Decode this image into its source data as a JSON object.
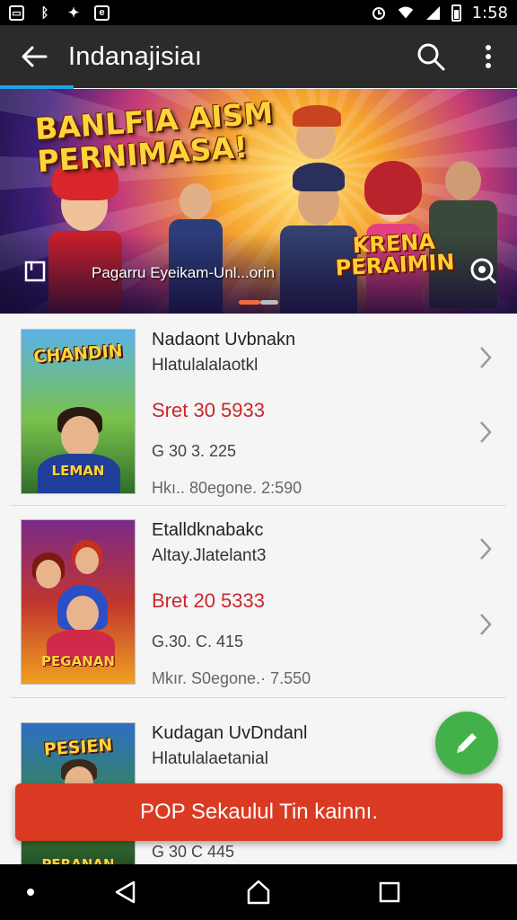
{
  "status_bar": {
    "time": "1:58",
    "left_icons": [
      "image-icon",
      "bluetooth-icon",
      "puzzle-icon",
      "e-app-icon"
    ],
    "right_icons": [
      "alarm-icon",
      "wifi-icon",
      "signal-icon",
      "battery-icon"
    ]
  },
  "app_bar": {
    "title": "Indanajisiaı",
    "back_icon": "arrow-left-icon",
    "search_icon": "search-icon",
    "menu_icon": "more-vert-icon",
    "accent": "#1ea3e8"
  },
  "banner": {
    "title_line1": "BANLFIA AISM",
    "title_line2": "PERNIMASA!",
    "logo_line1": "KRENA",
    "logo_line2": "PERAIMIN",
    "caption": "Pagarru Eyeikam-Unl...orin",
    "left_icon": "bookmark-icon",
    "right_icon": "zoom-icon",
    "pages": 2,
    "active_page": 1
  },
  "list": {
    "items": [
      {
        "thumb_title": "CHANDIN",
        "thumb_sub": "LEMAN",
        "name": "Nadaont Uvbnakn",
        "subtitle": "Hlatulalalaotkl",
        "price": "Sret 30 5933",
        "meta1": "G 30 3. 225",
        "meta2": "Hkı..  80egone.   2:590"
      },
      {
        "thumb_title": "",
        "thumb_sub": "PEGANAN",
        "name": "Etalldknabakc",
        "subtitle": "Altay.Jlatelant3",
        "price": "Bret 20 5333",
        "meta1": "G.30. C. 415",
        "meta2": "Mkır.  S0egone.·  7.550"
      },
      {
        "thumb_title": "PESIEN",
        "thumb_sub": "PERANAN",
        "name": "Kudagan UvDndanl",
        "subtitle": "Hlatulalaetanial",
        "price": "",
        "meta1": "G 30 C 445",
        "meta2": ""
      }
    ],
    "price_color": "#c8272b"
  },
  "fab": {
    "icon": "pencil-icon",
    "color": "#43b14a"
  },
  "snackbar": {
    "text": "POP Sekaulul Tin kainnı.",
    "color": "#db3a22"
  },
  "nav_bar": {
    "icons": [
      "dot-icon",
      "back-triangle-icon",
      "home-icon",
      "recents-icon"
    ]
  }
}
